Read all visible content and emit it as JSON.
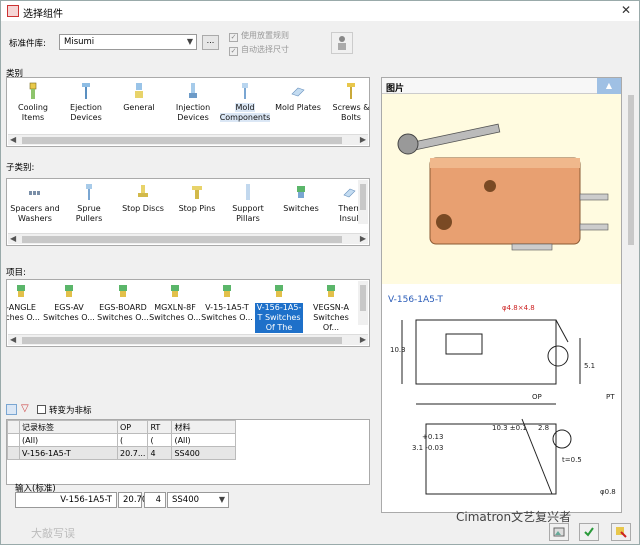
{
  "window": {
    "title": "选择组件",
    "close_glyph": "✕"
  },
  "std_lib": {
    "label": "标准件库:",
    "value": "Misumi",
    "browse_label": "..."
  },
  "options": {
    "use_placement_rule": "使用放置规则",
    "auto_select_size": "自动选择尺寸"
  },
  "category": {
    "label": "类别",
    "items": [
      {
        "label": "Cooling Items",
        "icon": "cooling-items-icon"
      },
      {
        "label": "Ejection Devices",
        "icon": "ejection-devices-icon"
      },
      {
        "label": "General",
        "icon": "general-icon"
      },
      {
        "label": "Injection Devices",
        "icon": "injection-devices-icon"
      },
      {
        "label": "Mold Components",
        "icon": "mold-components-icon"
      },
      {
        "label": "Mold Plates",
        "icon": "mold-plates-icon"
      },
      {
        "label": "Screws & Bolts",
        "icon": "screws-bolts-icon"
      }
    ]
  },
  "subcategory": {
    "label": "子类别:",
    "items": [
      {
        "label": "Spacers and Washers"
      },
      {
        "label": "Sprue Pullers"
      },
      {
        "label": "Stop Discs"
      },
      {
        "label": "Stop Pins"
      },
      {
        "label": "Support Pillars"
      },
      {
        "label": "Switches"
      },
      {
        "label": "Therr Insul"
      }
    ]
  },
  "items": {
    "label": "项目:",
    "list": [
      {
        "label": "-ANGLE tches O..."
      },
      {
        "label": "EGS-AV Switches O..."
      },
      {
        "label": "EGS-BOARD Switches O..."
      },
      {
        "label": "MGXLN-8F Switches O..."
      },
      {
        "label": "V-15-1A5-T Switches O..."
      },
      {
        "label": "V-156-1A5-T Switches Of The"
      },
      {
        "label": "VEGSN-A Switches Of..."
      }
    ]
  },
  "filter_bar": {
    "non_std_label": "转变为非标"
  },
  "table": {
    "headers": [
      "记录标签",
      "OP",
      "RT",
      "材料"
    ],
    "filter_row": [
      "(All)",
      "(",
      "(",
      "(All)"
    ],
    "rows": [
      [
        "V-156-1A5-T",
        "20.7...",
        "4",
        "SS400"
      ]
    ]
  },
  "input": {
    "label": "输入(标准)",
    "name": "V-156-1A5-T",
    "op": "20.700",
    "rt": "4",
    "material": "SS400"
  },
  "preview": {
    "header": "图片",
    "part_name": "V-156-1A5-T",
    "dims": {
      "hole": "φ4.8×4.8",
      "height": "10.3",
      "side": "5.1",
      "op": "OP",
      "pt": "PT",
      "d1": "10.3 ±0.1",
      "d2": "2.8",
      "d3": "+0.13",
      "d4": "3.1 -0.03",
      "d5": "t=0.5",
      "d6": "φ0.8"
    }
  },
  "watermark_left": "大敲写误",
  "watermark_right": "Cimatron文艺复兴者",
  "colors": {
    "selection": "#1e70c9",
    "part_body": "#e8a071",
    "drawing": "#2a5cb8"
  }
}
